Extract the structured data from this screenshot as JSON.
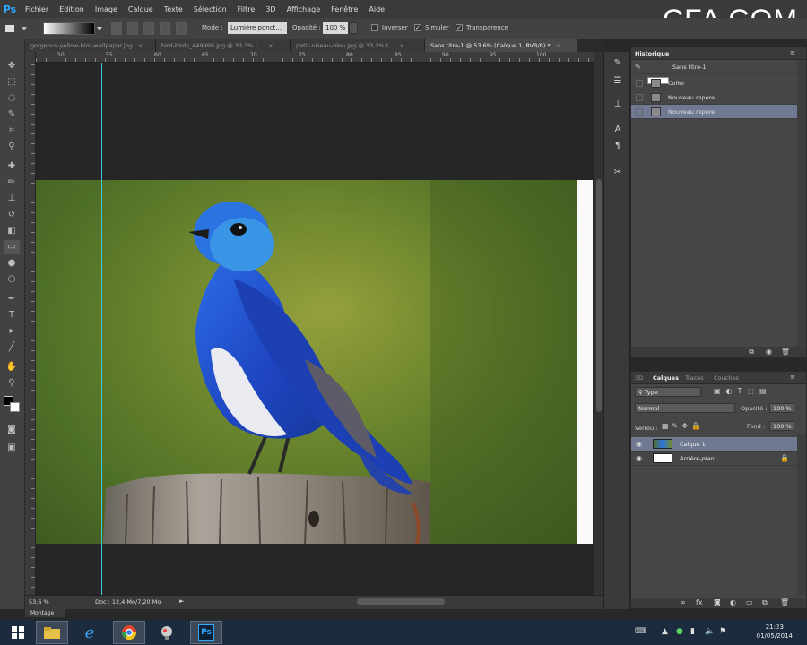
{
  "app": {
    "logo": "Ps"
  },
  "menu": [
    "Fichier",
    "Edition",
    "Image",
    "Calque",
    "Texte",
    "Sélection",
    "Filtre",
    "3D",
    "Affichage",
    "Fenêtre",
    "Aide"
  ],
  "watermark": "CFA COM",
  "options": {
    "mode_label": "Mode :",
    "mode_value": "Lumière ponct...",
    "opacity_label": "Opacité :",
    "opacity_value": "100 %",
    "invert_label": "Inverser",
    "simulate_label": "Simuler",
    "transparency_label": "Transparence",
    "invert_checked": false,
    "simulate_checked": true,
    "transparency_checked": true
  },
  "tabs": [
    {
      "label": "gorgeous-yellow-bird-wallpaper.jpg",
      "close": "×",
      "active": false
    },
    {
      "label": "bird-birds_449999.jpg @ 33,3% (...",
      "close": "×",
      "active": false
    },
    {
      "label": "petit-oiseau-bleu.jpg @ 33,3% (...",
      "close": "×",
      "active": false
    },
    {
      "label": "Sans titre-1 @ 53,6% (Calque 1, RVB/8) *",
      "close": "×",
      "active": true
    }
  ],
  "ruler": {
    "h_labels": [
      "50",
      "55",
      "60",
      "65",
      "70",
      "75",
      "80",
      "85",
      "90",
      "95",
      "100"
    ]
  },
  "status": {
    "zoom": "53,6 %",
    "doc": "Doc : 12,4 Mo/7,20 Mo",
    "arrow": "►"
  },
  "workspace_tab": "Montage",
  "history": {
    "tab": "Historique",
    "items": [
      {
        "label": "Sans titre-1",
        "selected": false
      },
      {
        "label": "Coller",
        "selected": false
      },
      {
        "label": "Nouveau repère",
        "selected": false
      },
      {
        "label": "Nouveau repère",
        "selected": true
      }
    ]
  },
  "layers": {
    "tabs": [
      "3D",
      "Calques",
      "Tracés",
      "Couches"
    ],
    "active_tab": "Calques",
    "filter_type": "Type",
    "blend_mode": "Normal",
    "opacity_label": "Opacité :",
    "opacity_value": "100 %",
    "lock_label": "Verrou :",
    "fill_label": "Fond :",
    "fill_value": "100 %",
    "items": [
      {
        "name": "Calque 1",
        "selected": true
      },
      {
        "name": "Arrière-plan",
        "selected": false
      }
    ]
  },
  "taskbar": {
    "time": "21:23",
    "date": "01/05/2014"
  },
  "colors": {
    "accent": "#31a8ff",
    "guide": "#43c7d8",
    "selection": "#6f7a92",
    "taskbar": "#1c2b3d"
  }
}
